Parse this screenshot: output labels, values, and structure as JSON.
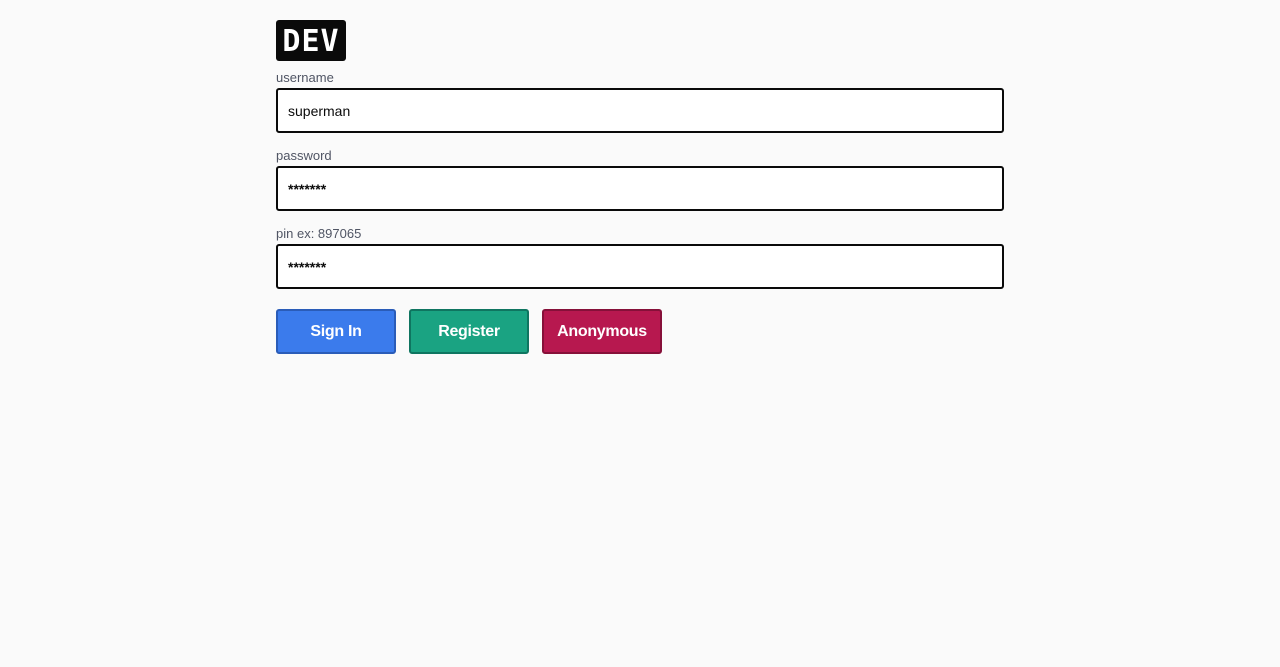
{
  "logo": {
    "text": "DEV"
  },
  "form": {
    "username": {
      "label": "username",
      "value": "superman"
    },
    "password": {
      "label": "password",
      "value": "*******"
    },
    "pin": {
      "label": "pin ex: 897065",
      "value": "*******"
    }
  },
  "buttons": {
    "sign_in": "Sign In",
    "register": "Register",
    "anonymous": "Anonymous"
  },
  "colors": {
    "background": "#fafafa",
    "sign_in": "#3b7bec",
    "register": "#1aa382",
    "anonymous": "#b7184f",
    "logo_bg": "#0a0a0a"
  }
}
